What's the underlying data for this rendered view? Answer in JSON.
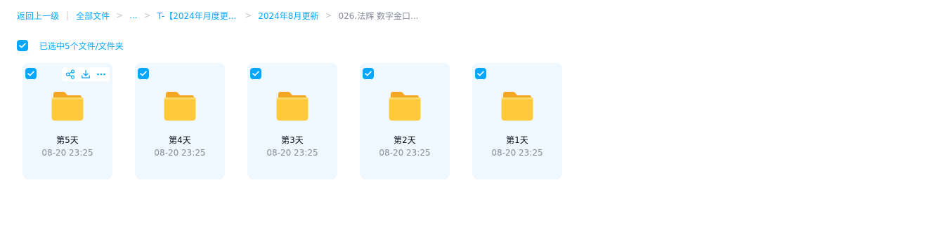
{
  "breadcrumb": {
    "back": "返回上一级",
    "sep_bar": "|",
    "sep": ">",
    "all_files": "全部文件",
    "ellipsis": "...",
    "level1": "T-【2024年月度更...",
    "level2": "2024年8月更新",
    "current": "026.法辉 数字金口..."
  },
  "selection": {
    "text": "已选中5个文件/文件夹"
  },
  "folders": [
    {
      "name": "第5天",
      "time": "08-20 23:25"
    },
    {
      "name": "第4天",
      "time": "08-20 23:25"
    },
    {
      "name": "第3天",
      "time": "08-20 23:25"
    },
    {
      "name": "第2天",
      "time": "08-20 23:25"
    },
    {
      "name": "第1天",
      "time": "08-20 23:25"
    }
  ],
  "colors": {
    "accent": "#06a7ff",
    "card_bg": "#eef8fe",
    "folder_yellow": "#ffc93c",
    "muted_text": "#878c9c"
  },
  "icons": {
    "checkbox": "checkmark-icon",
    "share": "share-icon",
    "download": "download-icon",
    "more": "more-icon",
    "folder": "folder-icon"
  }
}
